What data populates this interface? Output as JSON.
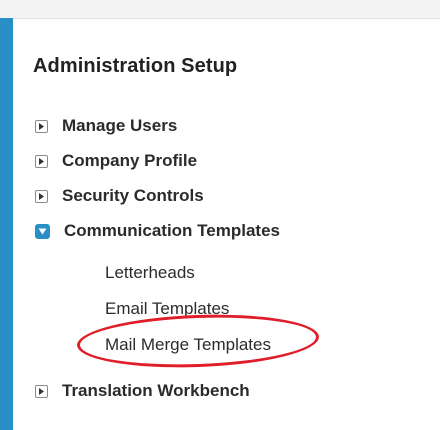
{
  "panel": {
    "title": "Administration Setup"
  },
  "nav": {
    "items": [
      {
        "label": "Manage Users",
        "state": "collapsed",
        "icon": "expand-triangle-icon"
      },
      {
        "label": "Company Profile",
        "state": "collapsed",
        "icon": "expand-triangle-icon"
      },
      {
        "label": "Security Controls",
        "state": "collapsed",
        "icon": "expand-triangle-icon"
      },
      {
        "label": "Communication Templates",
        "state": "expanded",
        "icon": "collapse-triangle-icon",
        "children": [
          {
            "label": "Letterheads"
          },
          {
            "label": "Email Templates",
            "highlighted": true
          },
          {
            "label": "Mail Merge Templates"
          }
        ]
      },
      {
        "label": "Translation Workbench",
        "state": "collapsed",
        "icon": "expand-triangle-icon"
      }
    ]
  },
  "colors": {
    "accent": "#2a8ec7",
    "highlight": "#e01e2a"
  }
}
